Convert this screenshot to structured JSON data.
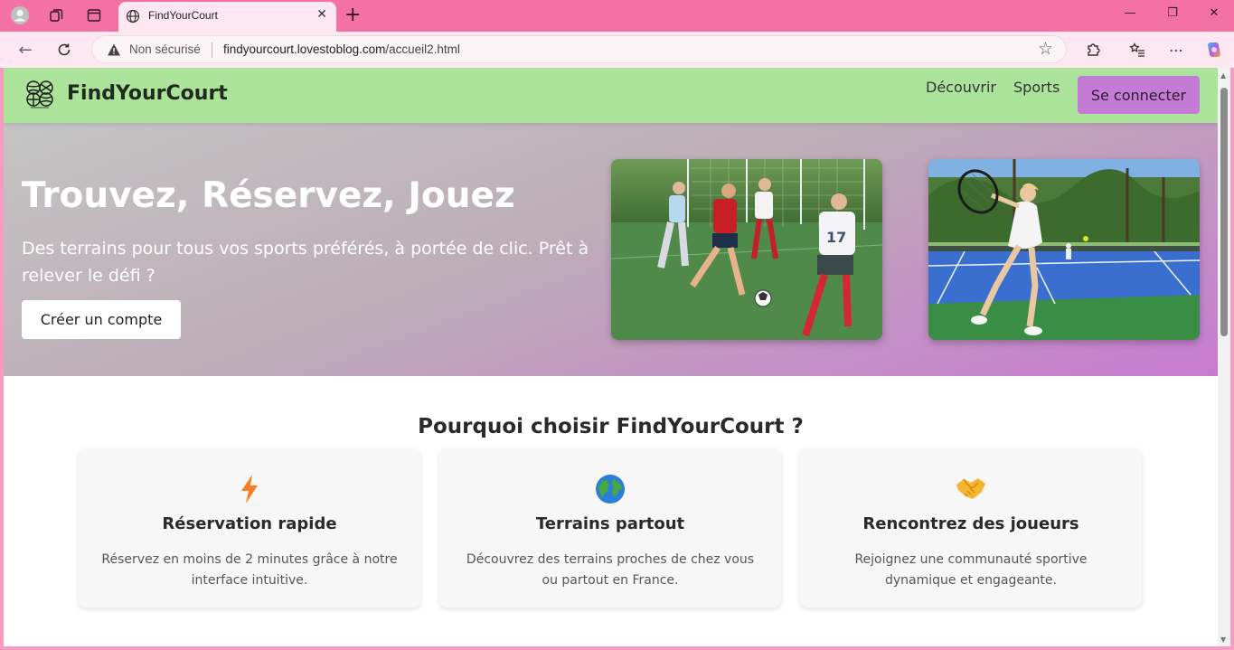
{
  "browser": {
    "tab_title": "FindYourCourt",
    "security_label": "Non sécurisé",
    "url_host": "findyourcourt.lovestoblog.com",
    "url_path": "/accueil2.html"
  },
  "header": {
    "brand": "FindYourCourt",
    "nav": [
      "Découvrir",
      "Sports"
    ],
    "login_label": "Se connecter"
  },
  "hero": {
    "title": "Trouvez, Réservez, Jouez",
    "subtitle": "Des terrains pour tous vos sports préférés, à portée de clic. Prêt à relever le défi ?",
    "cta_label": "Créer un compte"
  },
  "features": {
    "title": "Pourquoi choisir FindYourCourt ?",
    "cards": [
      {
        "icon": "lightning-icon",
        "title": "Réservation rapide",
        "text": "Réservez en moins de 2 minutes grâce à notre interface intuitive."
      },
      {
        "icon": "globe-icon",
        "title": "Terrains partout",
        "text": "Découvrez des terrains proches de chez vous ou partout en France."
      },
      {
        "icon": "handshake-icon",
        "title": "Rencontrez des joueurs",
        "text": "Rejoignez une communauté sportive dynamique et engageante."
      }
    ]
  },
  "colors": {
    "header_bg": "#ace39a",
    "accent_purple": "#c47bd5",
    "browser_pink": "#f472a3"
  }
}
